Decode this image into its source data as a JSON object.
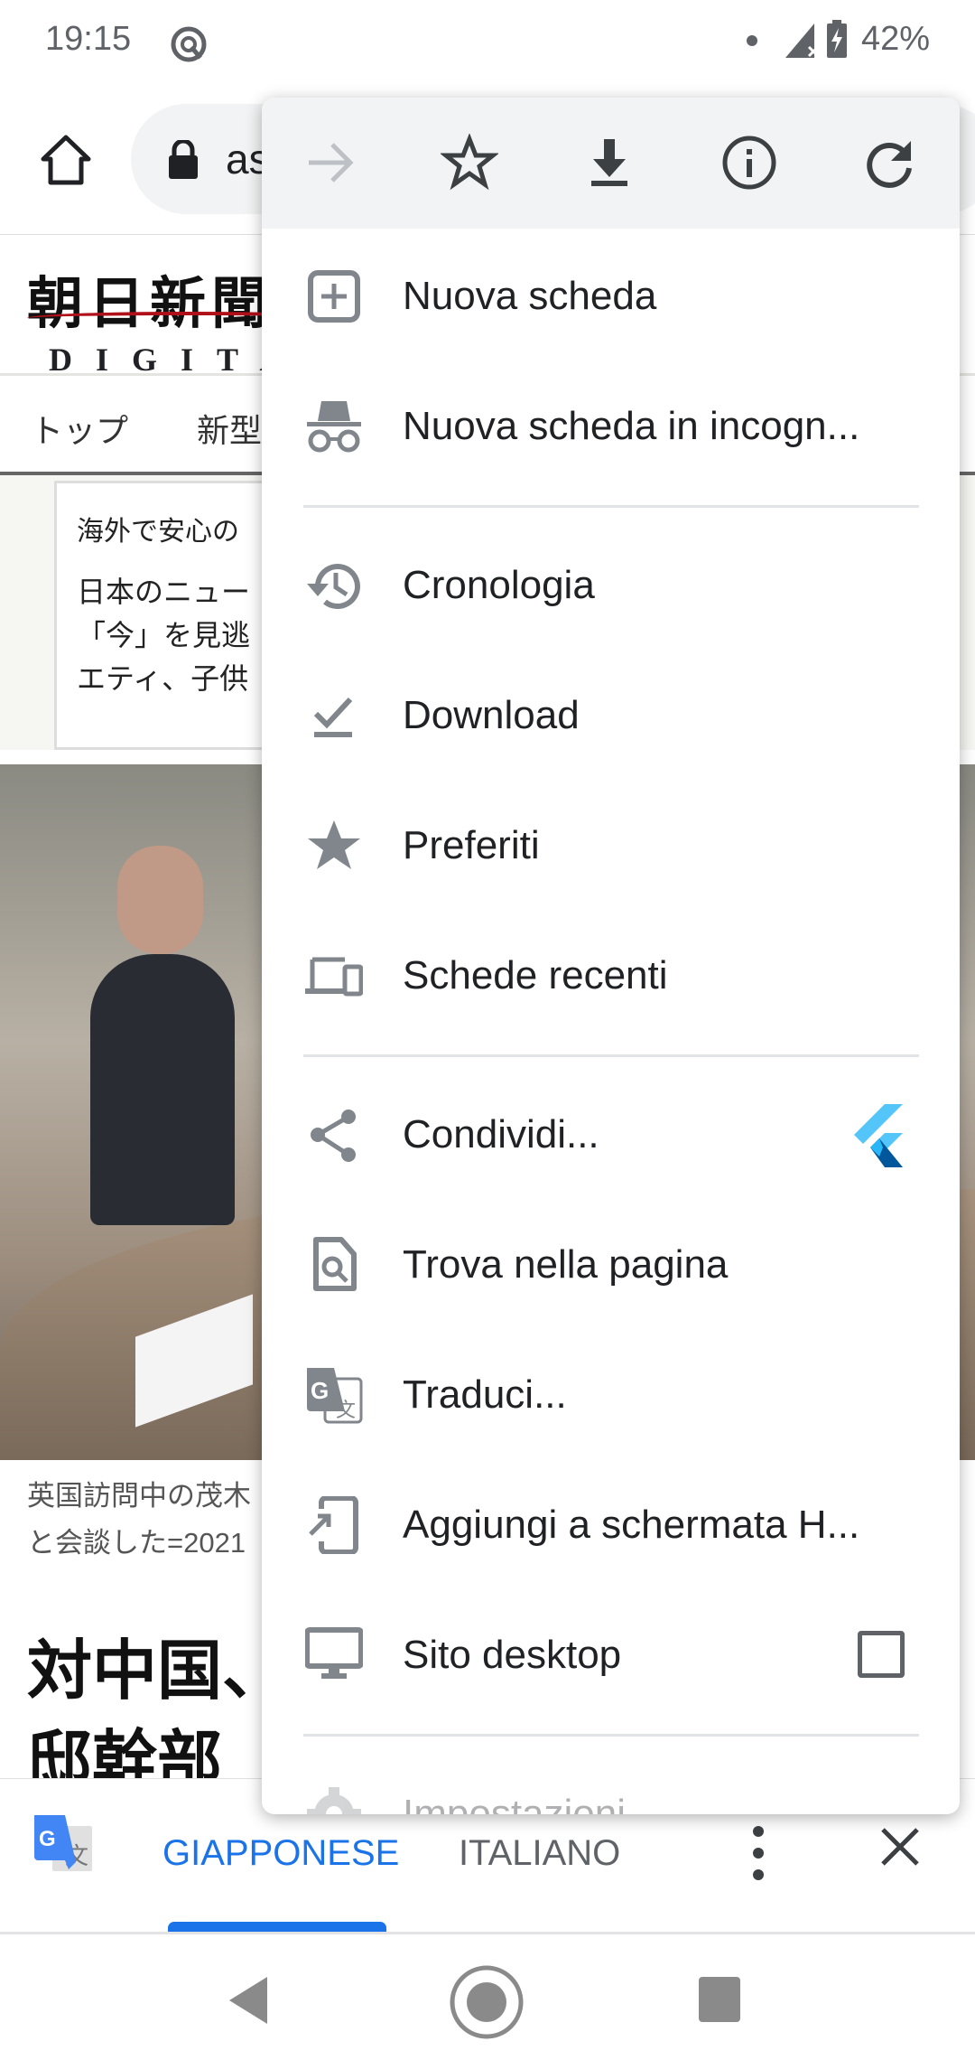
{
  "status_bar": {
    "time": "19:15",
    "battery": "42%"
  },
  "toolbar": {
    "url": "as"
  },
  "page": {
    "logo": {
      "jp": "朝日新聞",
      "en": "DIGITAL"
    },
    "nav": [
      "トップ",
      "新型"
    ],
    "ad": {
      "title": "海外で安心の",
      "lines": [
        "日本のニュー",
        "「今」を見逃",
        "エティ、子供"
      ]
    },
    "caption": [
      "英国訪問中の茂木",
      "と会談した=2021"
    ],
    "headline": [
      "対中国、",
      "邸幹部"
    ]
  },
  "menu": {
    "top_icons": [
      "forward-icon",
      "bookmark-star-icon",
      "download-icon",
      "info-icon",
      "reload-icon"
    ],
    "items": [
      {
        "label": "Nuova scheda",
        "icon": "new-tab-icon"
      },
      {
        "label": "Nuova scheda in incogn...",
        "icon": "incognito-icon"
      },
      {
        "label": "Cronologia",
        "icon": "history-icon"
      },
      {
        "label": "Download",
        "icon": "downloads-icon"
      },
      {
        "label": "Preferiti",
        "icon": "star-icon"
      },
      {
        "label": "Schede recenti",
        "icon": "devices-icon"
      },
      {
        "label": "Condividi...",
        "icon": "share-icon",
        "extra": "flutter-app-icon"
      },
      {
        "label": "Trova nella pagina",
        "icon": "find-in-page-icon"
      },
      {
        "label": "Traduci...",
        "icon": "translate-icon"
      },
      {
        "label": "Aggiungi a schermata H...",
        "icon": "add-to-home-icon"
      },
      {
        "label": "Sito desktop",
        "icon": "desktop-icon",
        "checkbox": false
      },
      {
        "label": "Impostazioni",
        "icon": "settings-icon"
      }
    ]
  },
  "translate_bar": {
    "source": "GIAPPONESE",
    "target": "ITALIANO",
    "selected": "GIAPPONESE",
    "accent": "#1a73e8"
  }
}
